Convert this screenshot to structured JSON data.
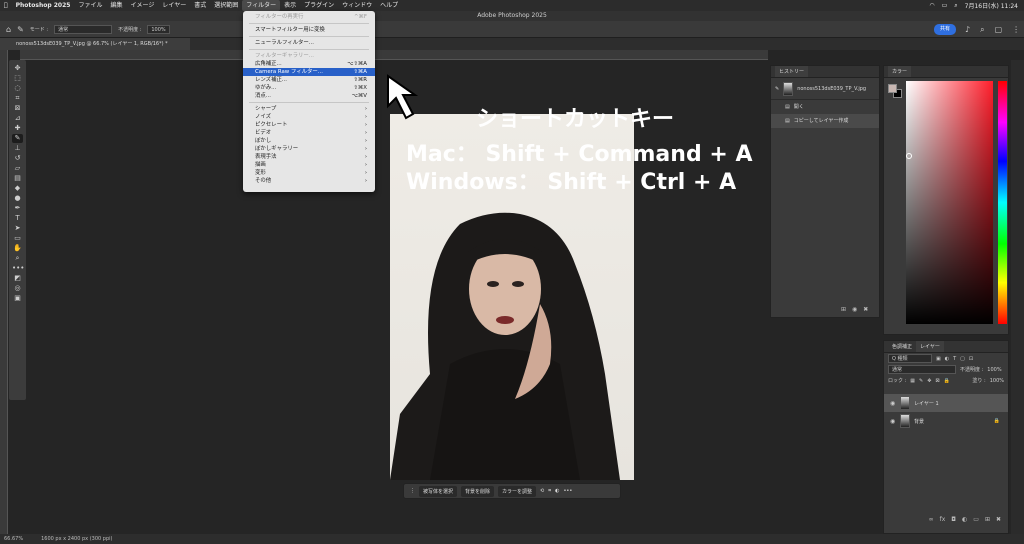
{
  "menubar": {
    "app_name": "Photoshop 2025",
    "items": [
      "ファイル",
      "編集",
      "イメージ",
      "レイヤー",
      "書式",
      "選択範囲",
      "フィルター",
      "表示",
      "プラグイン",
      "ウィンドウ",
      "ヘルプ"
    ],
    "active_index": 6,
    "clock": "7月16日(水) 11:24"
  },
  "window": {
    "title": "Adobe Photoshop 2025"
  },
  "options": {
    "mode_label": "モード :",
    "mode_value": "通常",
    "opacity_label": "不透明度 :",
    "opacity_value": "100%",
    "share_label": "共有"
  },
  "document": {
    "tab_title": "nonoss513dsE039_TP_V.jpg @ 66.7% (レイヤー 1, RGB/16*) *",
    "zoom": "66.67%",
    "size": "1600 px x 2400 px (300 ppi)"
  },
  "filter_menu": {
    "items": [
      {
        "label": "フィルターの再実行",
        "shortcut": "^⌘F",
        "disabled": true
      },
      {
        "sep": true
      },
      {
        "label": "スマートフィルター用に変換",
        "shortcut": ""
      },
      {
        "sep": true
      },
      {
        "label": "ニューラルフィルター...",
        "shortcut": ""
      },
      {
        "sep": true
      },
      {
        "label": "フィルターギャラリー...",
        "shortcut": "",
        "disabled": true
      },
      {
        "label": "広角補正...",
        "shortcut": "⌥⇧⌘A"
      },
      {
        "label": "Camera Raw フィルター...",
        "shortcut": "⇧⌘A",
        "highlight": true
      },
      {
        "label": "レンズ補正...",
        "shortcut": "⇧⌘R"
      },
      {
        "label": "ゆがみ...",
        "shortcut": "⇧⌘X"
      },
      {
        "label": "消点...",
        "shortcut": "⌥⌘V"
      },
      {
        "sep": true
      },
      {
        "label": "シャープ",
        "shortcut": "›"
      },
      {
        "label": "ノイズ",
        "shortcut": "›"
      },
      {
        "label": "ピクセレート",
        "shortcut": "›"
      },
      {
        "label": "ビデオ",
        "shortcut": "›"
      },
      {
        "label": "ぼかし",
        "shortcut": "›"
      },
      {
        "label": "ぼかしギャラリー",
        "shortcut": "›"
      },
      {
        "label": "表現手法",
        "shortcut": "›"
      },
      {
        "label": "描画",
        "shortcut": "›"
      },
      {
        "label": "変形",
        "shortcut": "›"
      },
      {
        "label": "その他",
        "shortcut": "›"
      }
    ]
  },
  "overlay": {
    "title": "ショートカットキー",
    "mac": "Mac：  Shift + Command + A",
    "windows": "Windows：  Shift + Ctrl + A"
  },
  "context_bar": {
    "select_subject": "被写体を選択",
    "remove_bg": "背景を削除",
    "adjust_color": "カラーを調整",
    "more": "•••"
  },
  "history_panel": {
    "tab": "ヒストリー",
    "snapshot": "nonoss513dsE039_TP_V.jpg",
    "steps": [
      "開く",
      "コピーしてレイヤー作成"
    ],
    "selected_index": 1
  },
  "color_panel": {
    "tab": "カラー",
    "fg_color": "#c8b7b2",
    "bg_color": "#000000"
  },
  "layers_panel": {
    "tabs": [
      "色調補正",
      "レイヤー"
    ],
    "active_tab": 1,
    "filter_kind": "Q 種類",
    "blend": "通常",
    "opacity_label": "不透明度 :",
    "opacity_value": "100%",
    "lock_label": "ロック :",
    "fill_label": "塗り :",
    "fill_value": "100%",
    "layers": [
      {
        "name": "レイヤー 1",
        "selected": true
      },
      {
        "name": "背景",
        "locked": true
      }
    ]
  },
  "icons": {
    "apple": "apple-icon",
    "home": "home-icon",
    "search": "search-icon",
    "arrow": "arrow-pointer-icon",
    "lock": "lock-icon",
    "eye": "eye-icon"
  }
}
